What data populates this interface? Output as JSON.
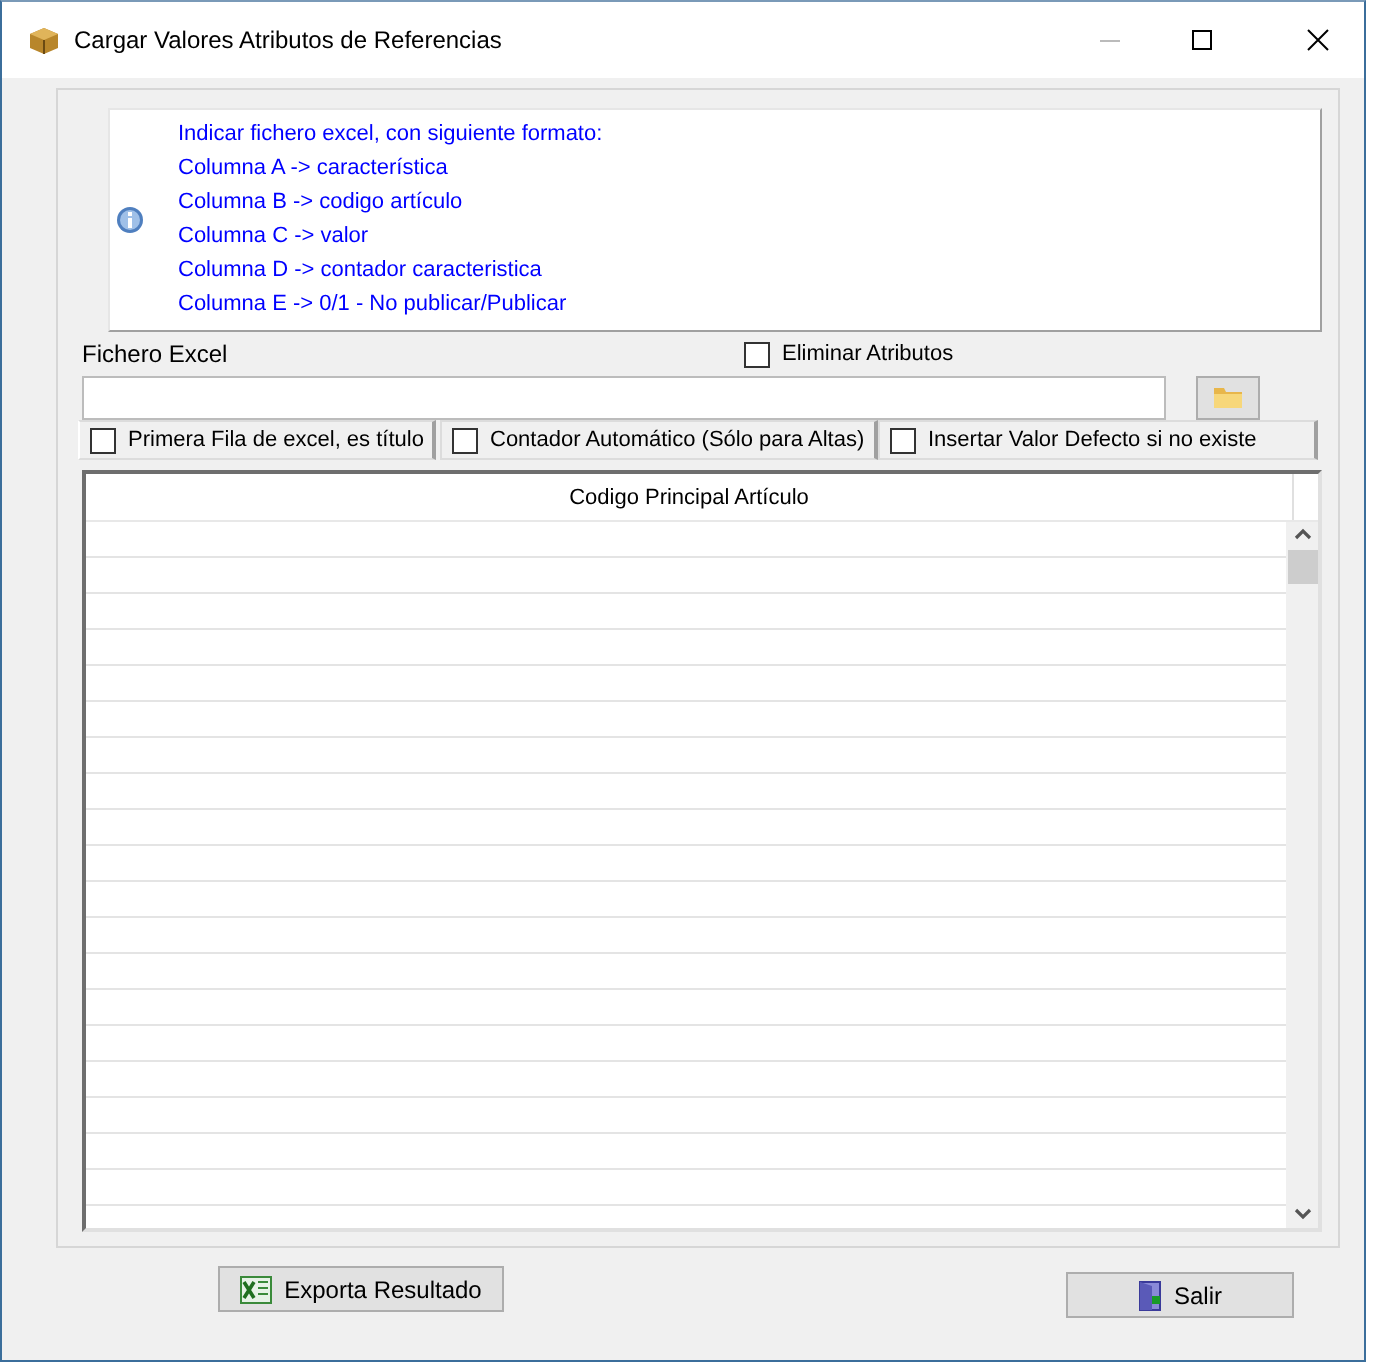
{
  "window": {
    "title": "Cargar Valores Atributos de Referencias"
  },
  "info": {
    "lines": [
      "Indicar fichero excel, con siguiente formato:",
      "Columna A -> característica",
      "Columna B -> codigo artículo",
      "Columna C -> valor",
      "Columna D -> contador caracteristica",
      "Columna E -> 0/1 - No publicar/Publicar"
    ]
  },
  "file": {
    "label": "Fichero Excel",
    "delete_option": {
      "label": "Eliminar Atributos",
      "checked": false
    }
  },
  "options": [
    {
      "label": "Primera Fila de excel, es título",
      "checked": false
    },
    {
      "label": "Contador Automático (Sólo para Altas)",
      "checked": false
    },
    {
      "label": "Insertar Valor Defecto si no existe",
      "checked": false
    }
  ],
  "table": {
    "columns": [
      "Codigo Principal Artículo"
    ]
  },
  "buttons": [
    {
      "kind": "export",
      "label": "Exporta Resultado"
    },
    {
      "kind": "exit",
      "label": "Salir"
    }
  ]
}
